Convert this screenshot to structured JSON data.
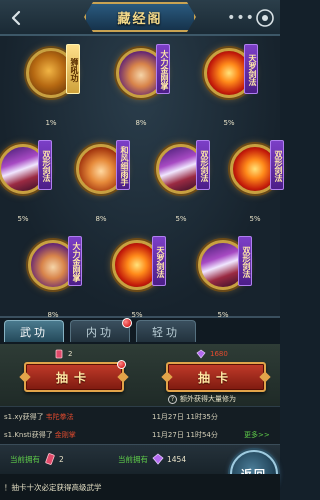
{
  "header": {
    "title": "藏经阁",
    "more_label": "•••"
  },
  "books": [
    {
      "name": "狮吼功",
      "percent": "1%",
      "art": "lion",
      "banner_style": "gold"
    },
    {
      "name": "大力金刚掌",
      "percent": "8%",
      "art": "palm",
      "banner_style": "purple"
    },
    {
      "name": "天罗剑法",
      "percent": "5%",
      "art": "fire",
      "banner_style": "purple"
    },
    {
      "name": "双形剑法",
      "percent": "5%",
      "art": "sword",
      "banner_style": "purple"
    },
    {
      "name": "和风细雨手",
      "percent": "8%",
      "art": "hand",
      "banner_style": "purple"
    },
    {
      "name": "双形剑法",
      "percent": "5%",
      "art": "sword",
      "banner_style": "purple"
    },
    {
      "name": "双形剑法",
      "percent": "5%",
      "art": "fire",
      "banner_style": "purple"
    },
    {
      "name": "大力金刚掌",
      "percent": "8%",
      "art": "palm",
      "banner_style": "purple"
    },
    {
      "name": "天罗剑法",
      "percent": "5%",
      "art": "fire",
      "banner_style": "purple"
    },
    {
      "name": "双形剑法",
      "percent": "5%",
      "art": "sword",
      "banner_style": "purple"
    }
  ],
  "tabs": [
    {
      "label": "武功"
    },
    {
      "label": "内功"
    },
    {
      "label": "轻功"
    }
  ],
  "draw": {
    "left_cost": "2",
    "right_cost": "1680",
    "button_label": "抽卡",
    "note": "额外获得大量修为"
  },
  "log": [
    {
      "who": "s1.xy获得了",
      "item": "韦陀拳法",
      "time": "11月27日 11时35分",
      "more": ""
    },
    {
      "who": "s1.Knsti获得了",
      "item": "金刚掌",
      "time": "11月27日 11时54分",
      "more": "更多>>"
    }
  ],
  "inventory": {
    "label1": "当前拥有",
    "value1": "2",
    "label2": "当前拥有",
    "value2": "1454"
  },
  "return_label": "返回",
  "tip": "！抽卡十次必定获得高级武学",
  "colors": {
    "accent_gold": "#c9a352",
    "draw_red": "#c23b2a",
    "log_red": "#e34b2e",
    "more_green": "#5fcc4a"
  }
}
